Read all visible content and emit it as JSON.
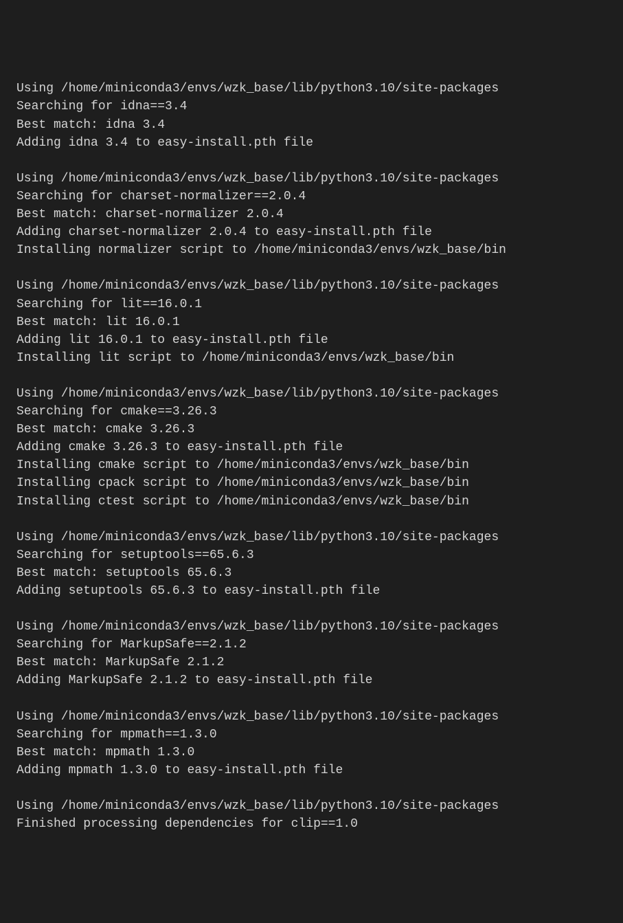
{
  "terminal": {
    "lines": [
      "Using /home/miniconda3/envs/wzk_base/lib/python3.10/site-packages",
      "Searching for idna==3.4",
      "Best match: idna 3.4",
      "Adding idna 3.4 to easy-install.pth file",
      "",
      "Using /home/miniconda3/envs/wzk_base/lib/python3.10/site-packages",
      "Searching for charset-normalizer==2.0.4",
      "Best match: charset-normalizer 2.0.4",
      "Adding charset-normalizer 2.0.4 to easy-install.pth file",
      "Installing normalizer script to /home/miniconda3/envs/wzk_base/bin",
      "",
      "Using /home/miniconda3/envs/wzk_base/lib/python3.10/site-packages",
      "Searching for lit==16.0.1",
      "Best match: lit 16.0.1",
      "Adding lit 16.0.1 to easy-install.pth file",
      "Installing lit script to /home/miniconda3/envs/wzk_base/bin",
      "",
      "Using /home/miniconda3/envs/wzk_base/lib/python3.10/site-packages",
      "Searching for cmake==3.26.3",
      "Best match: cmake 3.26.3",
      "Adding cmake 3.26.3 to easy-install.pth file",
      "Installing cmake script to /home/miniconda3/envs/wzk_base/bin",
      "Installing cpack script to /home/miniconda3/envs/wzk_base/bin",
      "Installing ctest script to /home/miniconda3/envs/wzk_base/bin",
      "",
      "Using /home/miniconda3/envs/wzk_base/lib/python3.10/site-packages",
      "Searching for setuptools==65.6.3",
      "Best match: setuptools 65.6.3",
      "Adding setuptools 65.6.3 to easy-install.pth file",
      "",
      "Using /home/miniconda3/envs/wzk_base/lib/python3.10/site-packages",
      "Searching for MarkupSafe==2.1.2",
      "Best match: MarkupSafe 2.1.2",
      "Adding MarkupSafe 2.1.2 to easy-install.pth file",
      "",
      "Using /home/miniconda3/envs/wzk_base/lib/python3.10/site-packages",
      "Searching for mpmath==1.3.0",
      "Best match: mpmath 1.3.0",
      "Adding mpmath 1.3.0 to easy-install.pth file",
      "",
      "Using /home/miniconda3/envs/wzk_base/lib/python3.10/site-packages",
      "Finished processing dependencies for clip==1.0"
    ]
  }
}
